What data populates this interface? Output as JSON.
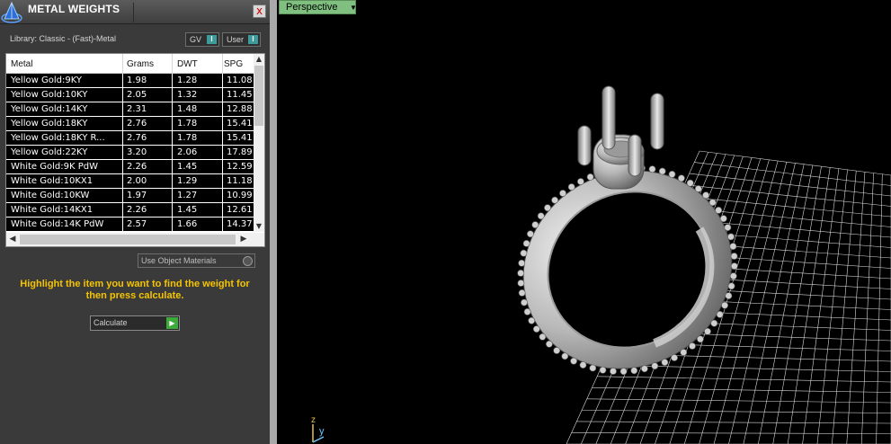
{
  "panel": {
    "title": "METAL WEIGHTS",
    "close_label": "x",
    "library_label": "Library: Classic - (Fast)-Metal",
    "dropdowns": {
      "gv": "GV",
      "user": "User"
    },
    "table": {
      "columns": [
        "Metal",
        "Grams",
        "DWT",
        "SPG"
      ],
      "rows": [
        [
          "Yellow Gold:9KY",
          "1.98",
          "1.28",
          "11.08"
        ],
        [
          "Yellow Gold:10KY",
          "2.05",
          "1.32",
          "11.45"
        ],
        [
          "Yellow Gold:14KY",
          "2.31",
          "1.48",
          "12.88"
        ],
        [
          "Yellow Gold:18KY",
          "2.76",
          "1.78",
          "15.41"
        ],
        [
          "Yellow Gold:18KY R...",
          "2.76",
          "1.78",
          "15.41"
        ],
        [
          "Yellow Gold:22KY",
          "3.20",
          "2.06",
          "17.89"
        ],
        [
          "White Gold:9K PdW",
          "2.26",
          "1.45",
          "12.59"
        ],
        [
          "White Gold:10KX1",
          "2.00",
          "1.29",
          "11.18"
        ],
        [
          "White Gold:10KW",
          "1.97",
          "1.27",
          "10.99"
        ],
        [
          "White Gold:14KX1",
          "2.26",
          "1.45",
          "12.61"
        ],
        [
          "White Gold:14K PdW",
          "2.57",
          "1.66",
          "14.37"
        ]
      ]
    },
    "use_object_materials_label": "Use Object Materials",
    "instructions": "Highlight the item you want to find the weight for then press calculate.",
    "calculate_label": "Calculate"
  },
  "viewport": {
    "tab_label": "Perspective",
    "axis_z": "z",
    "axis_y": "y"
  },
  "icons": {
    "logo": "pyramid-logo-icon",
    "close": "close-icon",
    "dropdown": "dropdown-arrow-icon",
    "play": "play-icon"
  },
  "colors": {
    "panel_bg": "#3a3a3a",
    "instructions": "#f5c400",
    "tab_accent": "#7fbf7f",
    "calculate_play": "#3cab3c",
    "dropdown_accent": "#3c9b9b"
  }
}
